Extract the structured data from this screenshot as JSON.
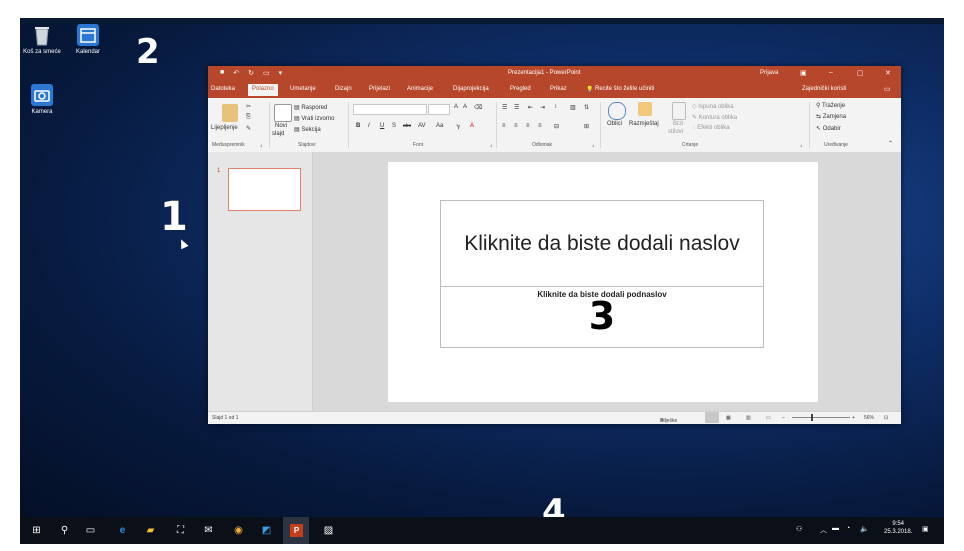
{
  "desktop": {
    "icons": [
      {
        "label": "Koš za smeće",
        "icon": "recycle-bin-icon"
      },
      {
        "label": "Kalendar",
        "icon": "calendar-icon"
      },
      {
        "label": "Kamera",
        "icon": "camera-icon"
      }
    ],
    "markers": [
      "1",
      "2",
      "3",
      "4"
    ]
  },
  "window": {
    "title": "Prezentacija1 - PowerPoint",
    "signin": "Prijava",
    "tabs": [
      "Datoteka",
      "Polazno",
      "Umetanje",
      "Dizajn",
      "Prijelazi",
      "Animacije",
      "Dijaprojekcija",
      "Pregled",
      "Prikaz"
    ],
    "active_tab": "Polazno",
    "tell_me": "Recite što želite učiniti",
    "share": "Zajednički koristi",
    "accent": "#b7472a"
  },
  "ribbon": {
    "clipboard": {
      "paste": "Lijepljenje",
      "group": "Međuspremnik"
    },
    "slides": {
      "new_slide": "Novi",
      "new_slide2": "slajd",
      "layout": "Raspored",
      "reset": "Vrati izvorno",
      "section": "Sekcija",
      "group": "Slajdovi"
    },
    "font": {
      "group": "Font",
      "bold": "B",
      "italic": "I",
      "underline": "U",
      "shadow": "S",
      "strike": "abc",
      "spacing": "AV",
      "case": "Aa",
      "color": "A"
    },
    "paragraph": {
      "group": "Odlomak"
    },
    "drawing": {
      "shapes": "Oblici",
      "arrange": "Razmještaj",
      "styles": "Brzi",
      "styles2": "stilovi",
      "fill": "Ispuna oblika",
      "outline": "Kontura oblika",
      "effects": "Efekti oblika",
      "group": "Crtanje"
    },
    "editing": {
      "find": "Traženje",
      "replace": "Zamjena",
      "select": "Odabir",
      "group": "Uređivanje"
    }
  },
  "slides_pane": {
    "slide_number": "1"
  },
  "slide": {
    "title_placeholder": "Kliknite da biste dodali naslov",
    "subtitle_placeholder": "Kliknite da biste dodali podnaslov"
  },
  "statusbar": {
    "slide_count": "Slajd 1 od 1",
    "notes": "Bilješke",
    "zoom": "56%"
  },
  "taskbar": {
    "icons": [
      "start-icon",
      "search-icon",
      "task-view-icon",
      "edge-icon",
      "file-explorer-icon",
      "store-icon",
      "mail-icon",
      "chrome-icon",
      "app-icon",
      "powerpoint-icon",
      "photos-icon"
    ],
    "time": "9:54",
    "date": "25.3.2018."
  }
}
